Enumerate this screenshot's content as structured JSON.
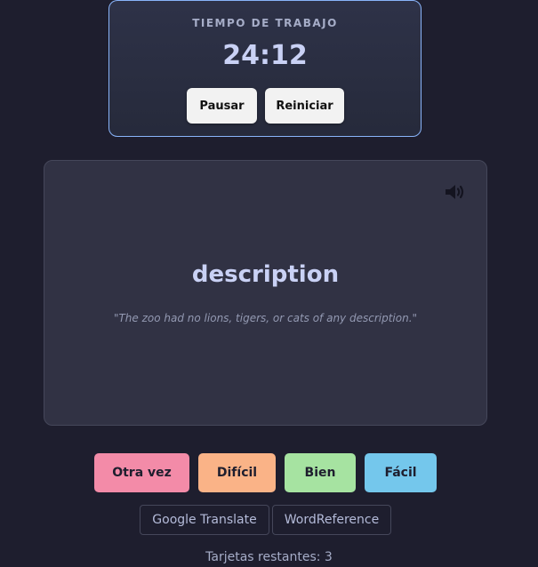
{
  "timer": {
    "label": "TIEMPO DE TRABAJO",
    "time": "24:12",
    "pause_label": "Pausar",
    "reset_label": "Reiniciar"
  },
  "card": {
    "speaker_icon": "speaker-icon",
    "word": "description",
    "example": "\"The zoo had no lions, tigers, or cats of any description.\""
  },
  "answers": {
    "again": "Otra vez",
    "hard": "Difícil",
    "good": "Bien",
    "easy": "Fácil"
  },
  "links": {
    "google": "Google Translate",
    "wordreference": "WordReference"
  },
  "status": {
    "remaining_label": "Tarjetas restantes:",
    "remaining_count": "3"
  },
  "colors": {
    "background": "#1e1e2e",
    "card": "#313244",
    "timer_border": "#89b4fa",
    "again": "#f38ba8",
    "hard": "#fab387",
    "good": "#a6e3a1",
    "easy": "#74c7ec"
  }
}
